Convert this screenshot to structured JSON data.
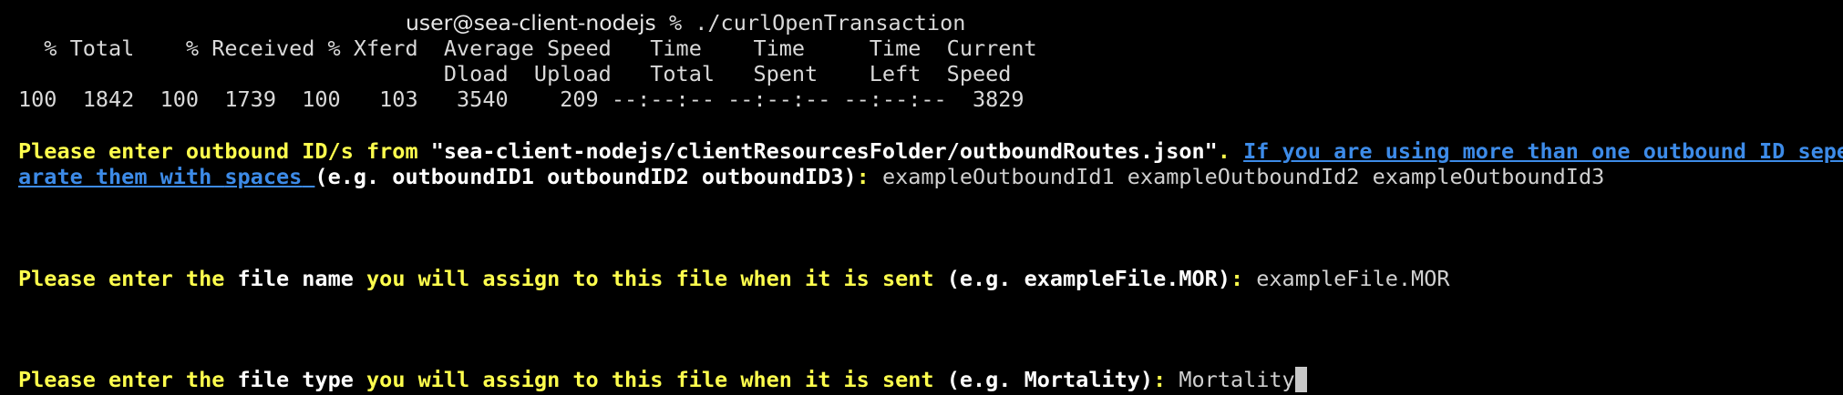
{
  "prompt": {
    "user_host": "user@sea-client-nodejs",
    "symbol": " % ",
    "command": "./curlOpenTransaction"
  },
  "curl": {
    "header1": "  % Total    % Received % Xferd  Average Speed   Time    Time     Time  Current",
    "header2": "                                 Dload  Upload   Total   Spent    Left  Speed",
    "stats": "100  1842  100  1739  100   103   3540    209 --:--:-- --:--:-- --:--:--  3829"
  },
  "outbound_prompt": {
    "part1": "Please enter outbound ID/s from ",
    "path": "\"sea-client-nodejs/clientResourcesFolder/outboundRoutes.json\"",
    "part2": ". ",
    "link1": "If you are using more than one outbound ID sepe",
    "link2a": "arate them with ",
    "link2b": "spaces",
    "link2c": " ",
    "example": "(e.g. outboundID1 outboundID2 outboundID3)",
    "colon": ": ",
    "value": "exampleOutboundId1 exampleOutboundId2 exampleOutboundId3"
  },
  "filename_prompt": {
    "part1": "Please enter the ",
    "kw": "file name",
    "part2": " you will assign to this file when it is sent ",
    "example": "(e.g. exampleFile.MOR)",
    "colon": ": ",
    "value": "exampleFile.MOR"
  },
  "filetype_prompt": {
    "part1": "Please enter the ",
    "kw": "file type",
    "part2": " you will assign to this file when it is sent ",
    "example": "(e.g. Mortality)",
    "colon": ": ",
    "value": "Mortality"
  },
  "colors": {
    "background": "#000000",
    "prompt_yellow": "#ffff4d",
    "link_blue": "#3d8be8",
    "text": "#d0d0d0"
  }
}
